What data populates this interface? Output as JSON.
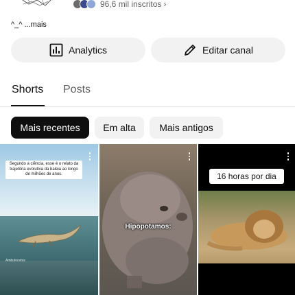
{
  "channel": {
    "subscribers": "96,6 mil inscritos",
    "description": "^_^ ...mais"
  },
  "actions": {
    "analytics_label": "Analytics",
    "edit_label": "Editar canal"
  },
  "tabs": [
    {
      "label": "Shorts",
      "selected": true
    },
    {
      "label": "Posts",
      "selected": false
    }
  ],
  "filters": [
    {
      "label": "Mais recentes",
      "selected": true
    },
    {
      "label": "Em alta",
      "selected": false
    },
    {
      "label": "Mais antigos",
      "selected": false
    }
  ],
  "shorts": [
    {
      "caption": "Segundo a ciência, esse é o relato da trajetória evolutiva da baleia ao longo de milhões de anos.",
      "small_text": "Ambulocetus"
    },
    {
      "caption": "Hipopotamos:"
    },
    {
      "caption": "16 horas por dia"
    }
  ],
  "colors": {
    "accent": "#0f0f0f",
    "chip_bg": "#f2f2f2",
    "secondary_text": "#606060"
  },
  "icons": [
    "analytics-icon",
    "pencil-icon",
    "chevron-right-icon",
    "kebab-icon"
  ]
}
